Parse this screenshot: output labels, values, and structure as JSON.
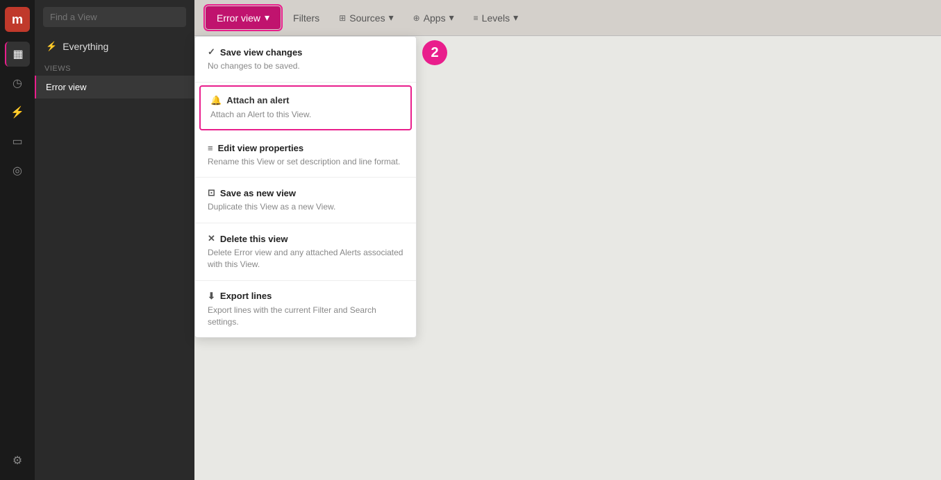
{
  "app": {
    "logo_letter": "m"
  },
  "icon_sidebar": {
    "nav_items": [
      {
        "id": "dashboard",
        "icon": "▦",
        "active": true
      },
      {
        "id": "history",
        "icon": "◷",
        "active": false
      },
      {
        "id": "pulse",
        "icon": "⚡",
        "active": false
      },
      {
        "id": "monitor",
        "icon": "▭",
        "active": false
      },
      {
        "id": "speed",
        "icon": "◎",
        "active": false
      },
      {
        "id": "settings",
        "icon": "⚙",
        "active": false
      }
    ]
  },
  "views_sidebar": {
    "search_placeholder": "Find a View",
    "everything_label": "Everything",
    "section_label": "Views",
    "view_items": [
      {
        "id": "error-view",
        "label": "Error view",
        "active": true
      }
    ]
  },
  "topbar": {
    "error_view_btn_label": "Error view",
    "dropdown_arrow": "▾",
    "filter_btn_label": "Filters",
    "sources_btn_label": "Sources",
    "apps_btn_label": "Apps",
    "levels_btn_label": "Levels",
    "sources_icon": "⊞",
    "apps_icon": "⊕",
    "levels_icon": "≡"
  },
  "dropdown": {
    "items": [
      {
        "id": "save-view-changes",
        "icon": "✓",
        "title": "Save view changes",
        "description": "No changes to be saved.",
        "highlighted": false
      },
      {
        "id": "attach-alert",
        "icon": "🔔",
        "title": "Attach an alert",
        "description": "Attach an Alert to this View.",
        "highlighted": true
      },
      {
        "id": "edit-view-properties",
        "icon": "≡",
        "title": "Edit view properties",
        "description": "Rename this View or set description and line format.",
        "highlighted": false
      },
      {
        "id": "save-as-new-view",
        "icon": "⊡",
        "title": "Save as new view",
        "description": "Duplicate this View as a new View.",
        "highlighted": false
      },
      {
        "id": "delete-this-view",
        "icon": "✕",
        "title": "Delete this view",
        "description": "Delete Error view and any attached Alerts associated with this View.",
        "highlighted": false
      },
      {
        "id": "export-lines",
        "icon": "⬇",
        "title": "Export lines",
        "description": "Export lines with the current Filter and Search settings.",
        "highlighted": false
      }
    ]
  },
  "step_badge": {
    "number": "2"
  }
}
